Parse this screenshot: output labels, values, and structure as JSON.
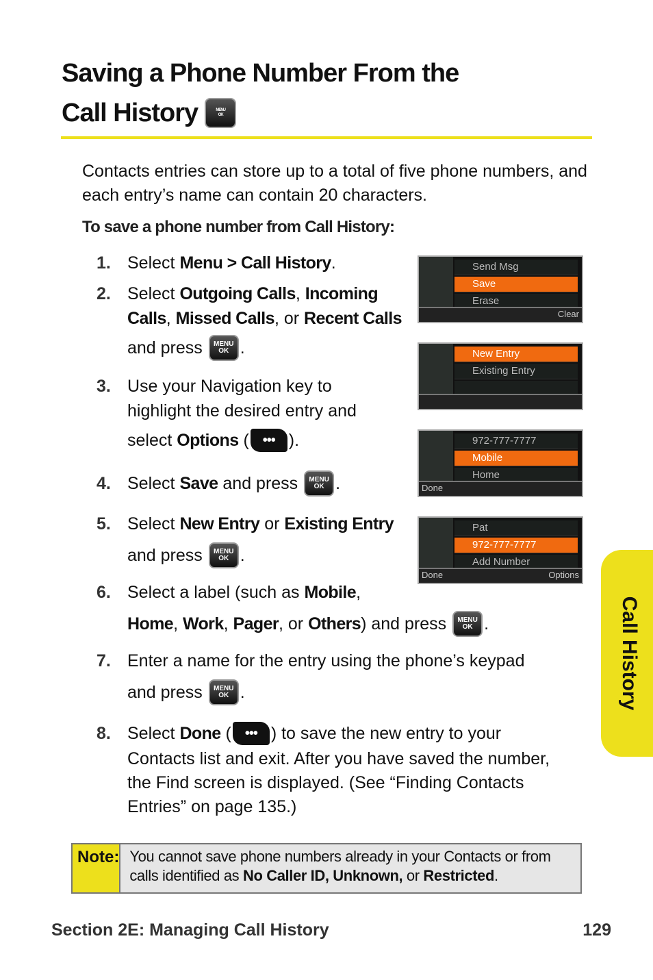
{
  "title": {
    "line1": "Saving a Phone Number From the",
    "line2": "Call History",
    "icon": "menu-ok-key-icon"
  },
  "intro": "Contacts entries can store up to a total of five phone numbers, and each entry’s name can contain 20 characters.",
  "subhead": "To save a phone number from Call History:",
  "menu_key": {
    "top": "MENU",
    "bottom": "OK"
  },
  "soft_key": "•••",
  "steps": [
    {
      "num": "1.",
      "lines": [
        [
          {
            "t": "Select "
          },
          {
            "t": "Menu > Call History",
            "b": true
          },
          {
            "t": "."
          }
        ]
      ]
    },
    {
      "num": "2.",
      "lines": [
        [
          {
            "t": "Select "
          },
          {
            "t": "Outgoing Calls",
            "b": true
          },
          {
            "t": ", "
          },
          {
            "t": "Incoming",
            "b": true
          }
        ],
        [
          {
            "t": "Calls",
            "b": true
          },
          {
            "t": ", "
          },
          {
            "t": "Missed Calls",
            "b": true
          },
          {
            "t": ", or "
          },
          {
            "t": "Recent Calls",
            "b": true
          }
        ],
        [
          {
            "t": "and press "
          },
          {
            "icon": "menu"
          },
          {
            "t": "."
          }
        ]
      ]
    },
    {
      "num": "3.",
      "lines": [
        [
          {
            "t": "Use your Navigation key to"
          }
        ],
        [
          {
            "t": "highlight the desired entry and"
          }
        ],
        [
          {
            "t": "select "
          },
          {
            "t": "Options",
            "b": true
          },
          {
            "t": " ("
          },
          {
            "icon": "soft"
          },
          {
            "t": ")."
          }
        ]
      ]
    },
    {
      "num": "4.",
      "lines": [
        [
          {
            "t": "Select "
          },
          {
            "t": "Save",
            "b": true
          },
          {
            "t": " and press "
          },
          {
            "icon": "menu"
          },
          {
            "t": "."
          }
        ]
      ]
    },
    {
      "num": "5.",
      "lines": [
        [
          {
            "t": "Select "
          },
          {
            "t": "New Entry",
            "b": true
          },
          {
            "t": " or "
          },
          {
            "t": "Existing Entry",
            "b": true
          }
        ],
        [
          {
            "t": "and press "
          },
          {
            "icon": "menu"
          },
          {
            "t": "."
          }
        ]
      ]
    },
    {
      "num": "6.",
      "lines": [
        [
          {
            "t": "Select a label (such as "
          },
          {
            "t": "Mobile",
            "b": true
          },
          {
            "t": ","
          }
        ],
        [
          {
            "t": "Home",
            "b": true
          },
          {
            "t": ", "
          },
          {
            "t": "Work",
            "b": true
          },
          {
            "t": ", "
          },
          {
            "t": "Pager",
            "b": true
          },
          {
            "t": ", or "
          },
          {
            "t": "Others",
            "b": true
          },
          {
            "t": ") and press "
          },
          {
            "icon": "menu"
          },
          {
            "t": "."
          }
        ]
      ]
    },
    {
      "num": "7.",
      "lines": [
        [
          {
            "t": "Enter a name for the entry using the phone’s keypad"
          }
        ],
        [
          {
            "t": "and press "
          },
          {
            "icon": "menu"
          },
          {
            "t": "."
          }
        ]
      ]
    },
    {
      "num": "8.",
      "lines": [
        [
          {
            "t": "Select "
          },
          {
            "t": "Done",
            "b": true
          },
          {
            "t": " ("
          },
          {
            "icon": "soft"
          },
          {
            "t": ") to save the new entry to your"
          }
        ],
        [
          {
            "t": "Contacts list and exit. After you have saved the number,"
          }
        ],
        [
          {
            "t": "the Find screen is displayed. (See “Finding Contacts"
          }
        ],
        [
          {
            "t": "Entries” on page 135.)"
          }
        ]
      ]
    }
  ],
  "screens": [
    {
      "rows": [
        "Send Msg",
        "Save",
        "Erase"
      ],
      "selected": 1,
      "left_soft": "",
      "right_soft": "Clear"
    },
    {
      "rows": [
        "New Entry",
        "Existing Entry",
        "",
        ""
      ],
      "selected": 0,
      "left_soft": "",
      "right_soft": ""
    },
    {
      "rows": [
        "972-777-7777",
        "Mobile",
        "Home"
      ],
      "selected": 1,
      "left_soft": "Done",
      "right_soft": ""
    },
    {
      "rows": [
        "Pat",
        "972-777-7777",
        "Add Number"
      ],
      "selected": 1,
      "left_soft": "Done",
      "right_soft": "Options"
    }
  ],
  "side_tab": "Call History",
  "note": {
    "label": "Note:",
    "text1": "You cannot save phone numbers already in your Contacts or from calls identified as ",
    "bold1": "No Caller ID, Unknown,",
    "text2": " or ",
    "bold2": "Restricted",
    "text3": "."
  },
  "footer": {
    "section": "Section 2E: Managing Call History",
    "page": "129"
  },
  "colors": {
    "accent_yellow": "#ede01c",
    "highlight_orange": "#f06a10"
  }
}
